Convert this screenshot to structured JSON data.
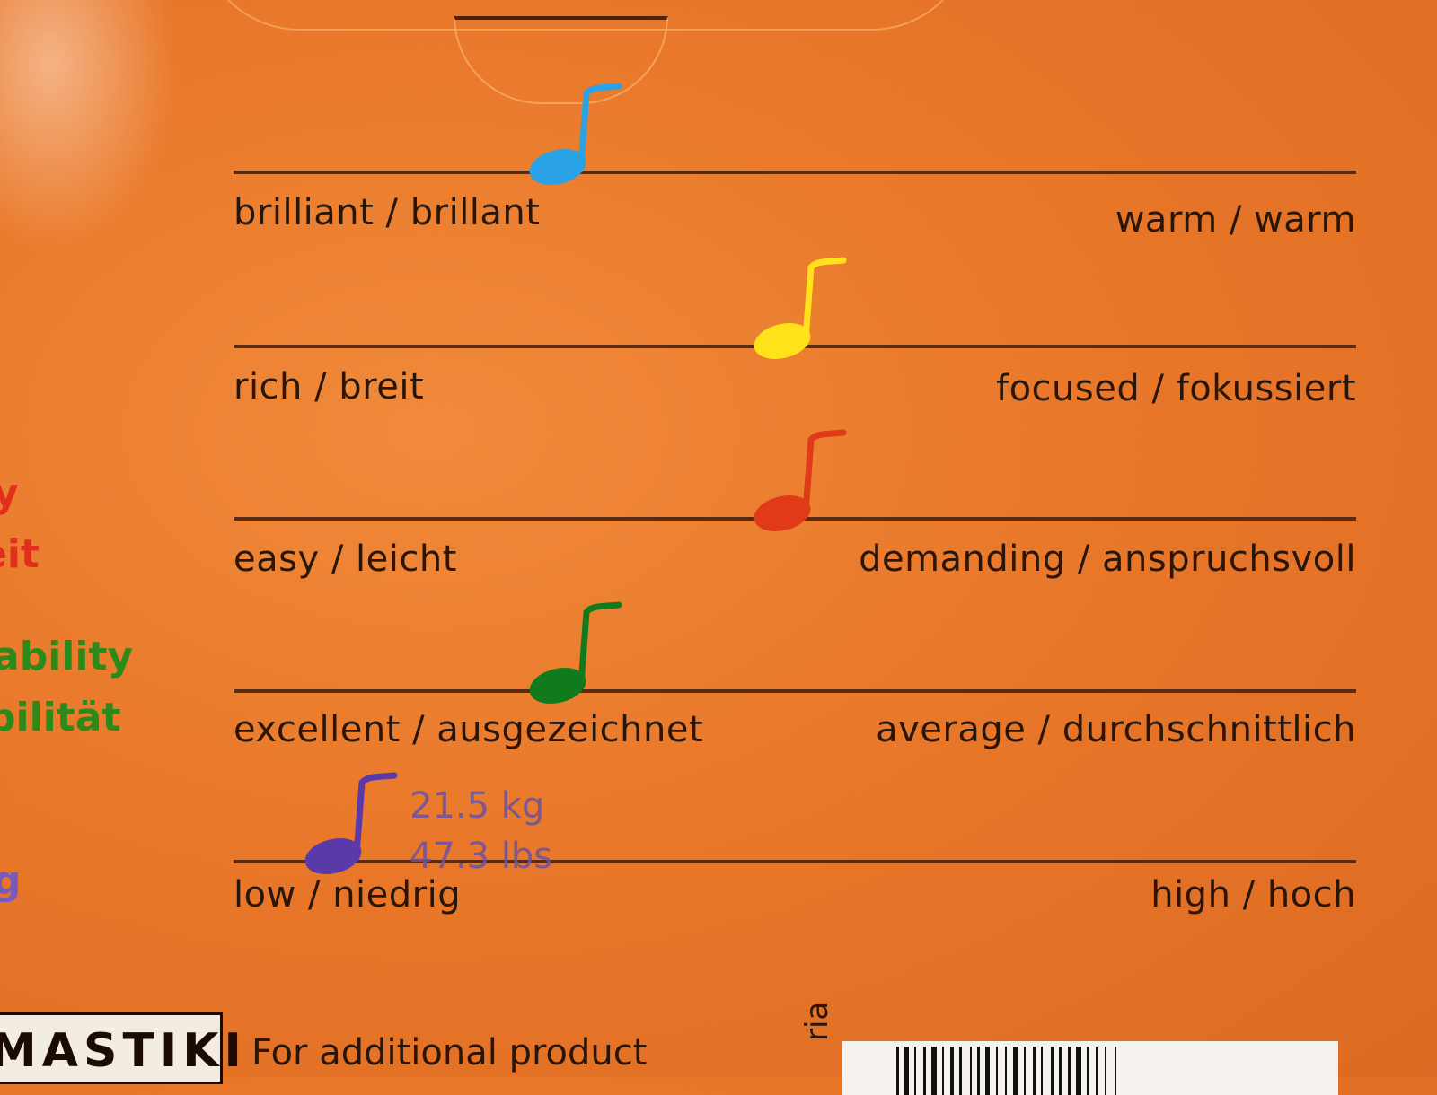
{
  "scales": [
    {
      "left": "brilliant / brillant",
      "right": "warm / warm",
      "position": 0.29,
      "note_color": "#2aa3e6",
      "note_icon": "blue-note-icon"
    },
    {
      "left": "rich / breit",
      "right": "focused / fokussiert",
      "position": 0.49,
      "note_color": "#ffe21a",
      "note_icon": "yellow-note-icon"
    },
    {
      "left": "easy / leicht",
      "right": "demanding / anspruchsvoll",
      "position": 0.49,
      "note_color": "#e03a18",
      "note_icon": "red-note-icon"
    },
    {
      "left": "excellent / ausgezeichnet",
      "right": "average / durchschnittlich",
      "position": 0.29,
      "note_color": "#117a1c",
      "note_icon": "green-note-icon"
    },
    {
      "left": "low / niedrig",
      "right": "high / hoch",
      "position": 0.09,
      "note_color": "#5a3aa8",
      "note_icon": "purple-note-icon"
    }
  ],
  "weight": {
    "kg": "21.5 kg",
    "lbs": "47.3 lbs"
  },
  "side_labels": [
    {
      "text": "y",
      "color": "#e0301c"
    },
    {
      "text": "eit",
      "color": "#e0301c"
    },
    {
      "text": "ability",
      "color": "#2d8a1a"
    },
    {
      "text": "bilität",
      "color": "#2d8a1a"
    },
    {
      "text": "g",
      "color": "#7a5ab8"
    }
  ],
  "footer": {
    "logo": "MASTIKI",
    "text": "For additional product",
    "side": "ria"
  }
}
